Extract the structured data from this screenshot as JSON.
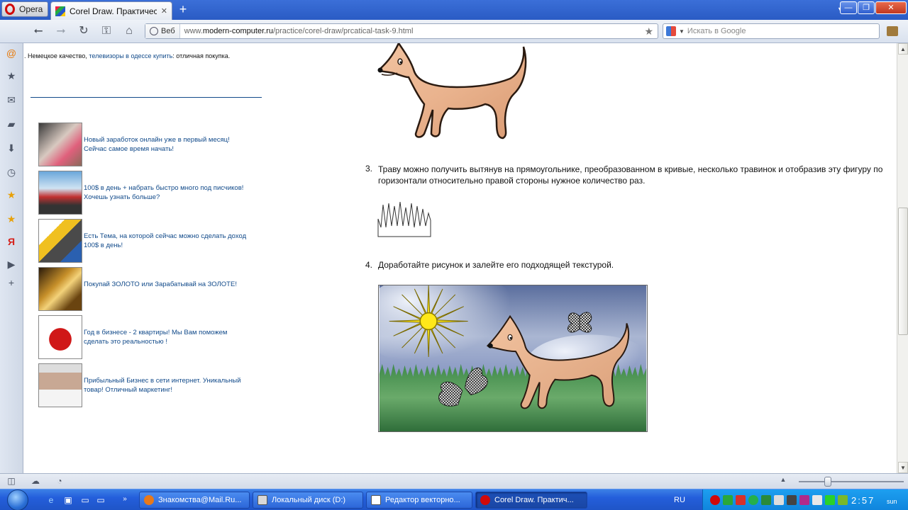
{
  "browser": {
    "menu_label": "Opera",
    "tab_title": "Corel Draw. Практическ…",
    "address": {
      "badge": "Веб",
      "url_prefix": "www.",
      "url_domain": "modern-computer.ru",
      "url_path": "/practice/corel-draw/prcatical-task-9.html"
    },
    "search_placeholder": "Искать в Google",
    "sidebar_icons": [
      "mail-icon",
      "bookmarks-star-icon",
      "envelope-icon",
      "notes-icon",
      "downloads-icon",
      "history-clock-icon",
      "favorite-star-icon",
      "favorite-star-icon",
      "yandex-icon",
      "media-play-icon",
      "add-panel-icon"
    ]
  },
  "page": {
    "promo": {
      "text_before": ". Немецкое качество, ",
      "link": "телевизоры в одессе купить",
      "text_after": ": отличная покупка."
    },
    "ads": [
      {
        "text": "Новый заработок онлайн уже в первый месяц! Сейчас самое время начать!"
      },
      {
        "text": "100$ в день + набрать быстро много под писчиков! Хочешь узнать больше?"
      },
      {
        "text": "Есть Тема, на которой сейчас можно сделать доход 100$ в день!"
      },
      {
        "text": "Покупай ЗОЛОТО или Зарабатывай на ЗОЛОТЕ!"
      },
      {
        "text": "Год в бизнесе - 2 квартиры! Мы Вам поможем сделать это реальностью !"
      },
      {
        "text": "Прибыльный Бизнес в сети интернет. Уникальный товар! Отличный маркетинг!"
      }
    ],
    "steps": [
      {
        "num": "3.",
        "text": "Траву можно получить вытянув на прямоугольнике, преобразованном в кривые, несколько травинок и отобразив эту фигуру по горизонтали относительно правой стороны нужное количество раз."
      },
      {
        "num": "4.",
        "text": "Доработайте рисунок и залейте его подходящей текстурой."
      }
    ]
  },
  "taskbar": {
    "buttons": [
      {
        "label": "Знакомства@Mail.Ru..."
      },
      {
        "label": "Локальный диск (D:)"
      },
      {
        "label": "Редактор векторно..."
      },
      {
        "label": "Corel Draw. Практич..."
      }
    ],
    "language": "RU",
    "clock": "2:57",
    "day": "sun"
  }
}
